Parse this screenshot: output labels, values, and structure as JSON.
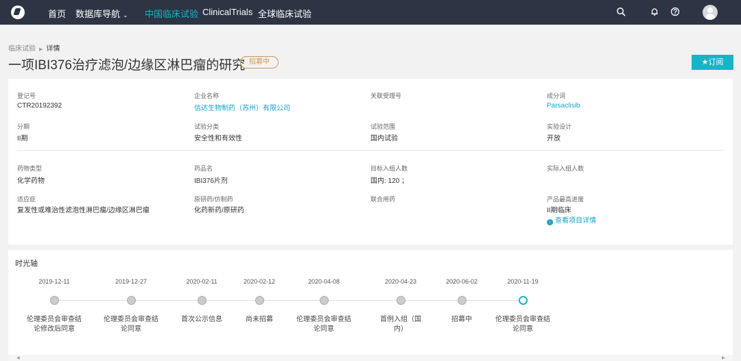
{
  "nav": {
    "home": "首页",
    "database_nav": "数据库导航",
    "china_trials": "中国临床试验",
    "clinical_trials": "ClinicalTrials",
    "global_trials": "全球临床试验"
  },
  "breadcrumb": {
    "root": "临床试验",
    "current": "详情"
  },
  "page": {
    "title": "一项IBI376治疗滤泡/边缘区淋巴瘤的研究",
    "status": "招募中",
    "subscribe": "★订阅"
  },
  "fields": {
    "reg_no": {
      "label": "登记号",
      "value": "CTR20192392"
    },
    "company": {
      "label": "企业名称",
      "value": "信达生物制药（苏州）有限公司"
    },
    "acceptance_no": {
      "label": "关联受理号",
      "value": ""
    },
    "ingredient": {
      "label": "成分词",
      "value": "Parsaclisib"
    },
    "phase": {
      "label": "分期",
      "value": "II期"
    },
    "trial_class": {
      "label": "试验分类",
      "value": "安全性和有效性"
    },
    "trial_scope": {
      "label": "试验范围",
      "value": "国内试验"
    },
    "design": {
      "label": "实验设计",
      "value": "开放"
    },
    "drug_type": {
      "label": "药物类型",
      "value": "化学药物"
    },
    "drug_name": {
      "label": "药品名",
      "value": "IBI376片剂"
    },
    "target_enroll": {
      "label": "目标入组人数",
      "value": "国内: 120 ；"
    },
    "actual_enroll": {
      "label": "实际入组人数",
      "value": ""
    },
    "indication": {
      "label": "适应症",
      "value": "复发性或难治性滤泡性淋巴瘤/边缘区淋巴瘤"
    },
    "original_generic": {
      "label": "原研药/仿制药",
      "value": "化药新药/原研药"
    },
    "combination": {
      "label": "联合用药",
      "value": ""
    },
    "max_progress": {
      "label": "产品最高进度",
      "value": "II期临床",
      "link": "查看项目详情"
    }
  },
  "timeline": {
    "title": "时光轴",
    "events": [
      {
        "date": "2019-12-11",
        "label": "伦理委员会审查结论修改后同意"
      },
      {
        "date": "2019-12-27",
        "label": "伦理委员会审查结论同意"
      },
      {
        "date": "2020-02-11",
        "label": "首次公示信息"
      },
      {
        "date": "2020-02-12",
        "label": "尚未招募"
      },
      {
        "date": "2020-04-08",
        "label": "伦理委员会审查结论同意"
      },
      {
        "date": "2020-04-23",
        "label": "首例入组（国内）"
      },
      {
        "date": "2020-06-02",
        "label": "招募中"
      },
      {
        "date": "2020-11-19",
        "label": "伦理委员会审查结论同意"
      }
    ]
  },
  "colors": {
    "accent": "#18b3c6",
    "topbar": "#2d3444",
    "status": "#c8985a"
  },
  "icons": [
    "logo-icon",
    "search-icon",
    "notification-icon",
    "help-icon",
    "avatar"
  ]
}
